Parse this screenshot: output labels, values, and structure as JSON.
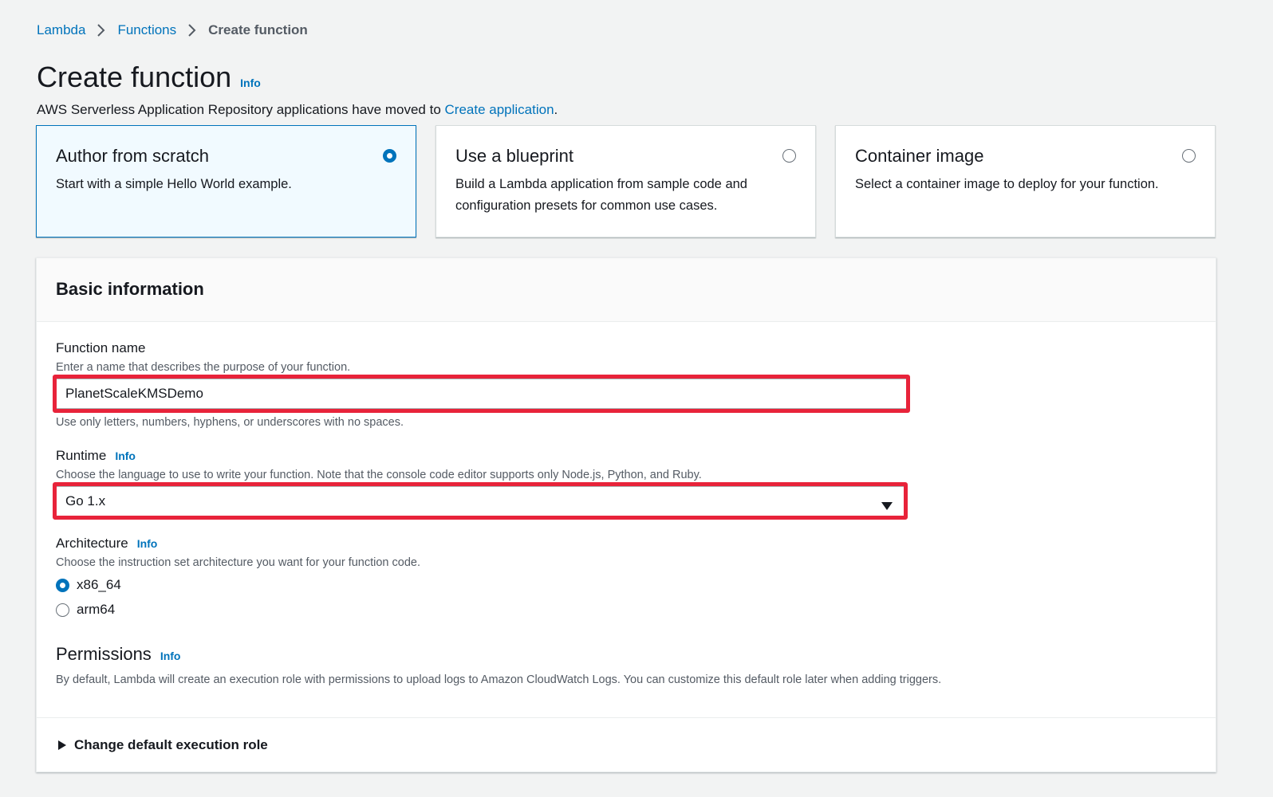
{
  "breadcrumb": {
    "items": [
      {
        "label": "Lambda"
      },
      {
        "label": "Functions"
      },
      {
        "label": "Create function"
      }
    ]
  },
  "header": {
    "title": "Create function",
    "info_label": "Info",
    "moved_note_prefix": "AWS Serverless Application Repository applications have moved to ",
    "moved_note_link": "Create application",
    "moved_note_suffix": "."
  },
  "options": [
    {
      "title": "Author from scratch",
      "description": "Start with a simple Hello World example.",
      "selected": true
    },
    {
      "title": "Use a blueprint",
      "description": "Build a Lambda application from sample code and configuration presets for common use cases.",
      "selected": false
    },
    {
      "title": "Container image",
      "description": "Select a container image to deploy for your function.",
      "selected": false
    }
  ],
  "basic_info": {
    "title": "Basic information",
    "function_name": {
      "label": "Function name",
      "description": "Enter a name that describes the purpose of your function.",
      "value": "PlanetScaleKMSDemo",
      "constraint": "Use only letters, numbers, hyphens, or underscores with no spaces."
    },
    "runtime": {
      "label": "Runtime",
      "info_label": "Info",
      "description": "Choose the language to use to write your function. Note that the console code editor supports only Node.js, Python, and Ruby.",
      "selected": "Go 1.x"
    },
    "architecture": {
      "label": "Architecture",
      "info_label": "Info",
      "description": "Choose the instruction set architecture you want for your function code.",
      "options": [
        {
          "label": "x86_64",
          "selected": true
        },
        {
          "label": "arm64",
          "selected": false
        }
      ]
    },
    "permissions": {
      "label": "Permissions",
      "info_label": "Info",
      "description": "By default, Lambda will create an execution role with permissions to upload logs to Amazon CloudWatch Logs. You can customize this default role later when adding triggers."
    },
    "expander_label": "Change default execution role"
  },
  "colors": {
    "link": "#0073bb",
    "highlight": "#e8233a",
    "selected_tile_bg": "#f1faff"
  },
  "icons": {
    "breadcrumb_separator": "chevron-right-icon",
    "select_caret": "caret-down-icon",
    "expander": "caret-right-icon"
  }
}
